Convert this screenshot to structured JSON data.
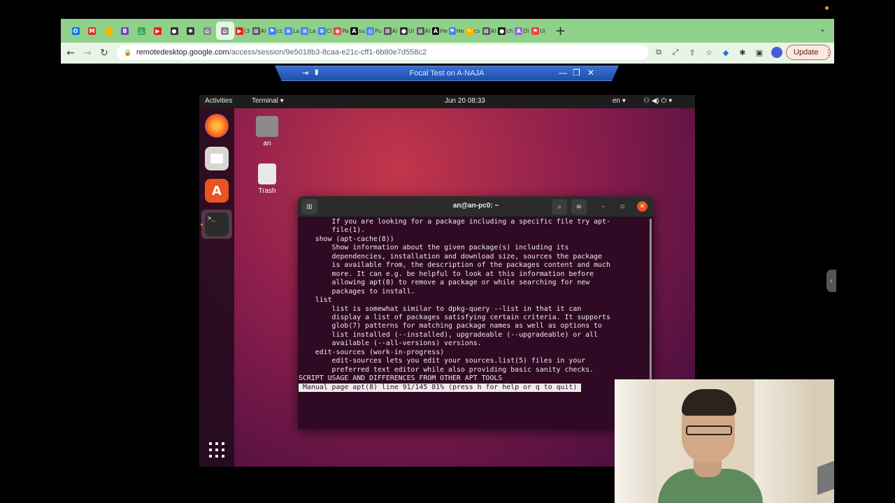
{
  "browser": {
    "tabs": [
      {
        "icon": "outlook-icon",
        "color": "#1a73e8",
        "glyph": "O",
        "label": ""
      },
      {
        "icon": "gmail-icon",
        "color": "#d93025",
        "glyph": "M",
        "label": ""
      },
      {
        "icon": "puzzle-yellow-icon",
        "color": "#f4b400",
        "glyph": "",
        "label": ""
      },
      {
        "icon": "bold-b-icon",
        "color": "#6f42c1",
        "glyph": "B",
        "label": ""
      },
      {
        "icon": "drive-icon",
        "color": "#34a853",
        "glyph": "△",
        "label": ""
      },
      {
        "icon": "youtube-icon",
        "color": "#e62117",
        "glyph": "▶",
        "label": ""
      },
      {
        "icon": "circle-dark-icon",
        "color": "#333",
        "glyph": "●",
        "label": ""
      },
      {
        "icon": "extension-icon",
        "color": "#333",
        "glyph": "✱",
        "label": ""
      },
      {
        "icon": "remote-desktop-icon",
        "color": "#888",
        "glyph": "⌂",
        "label": ""
      },
      {
        "icon": "remote-desktop-icon",
        "color": "#888",
        "glyph": "⌂",
        "label": "",
        "active": true
      },
      {
        "icon": "youtube-icon",
        "color": "#e62117",
        "glyph": "▶",
        "label": "(3"
      },
      {
        "icon": "ai-tab-icon",
        "color": "#555",
        "glyph": "⊞",
        "label": "Al"
      },
      {
        "icon": "flag-tab-icon",
        "color": "#4285f4",
        "glyph": "⚑",
        "label": "cc"
      },
      {
        "icon": "docs-icon",
        "color": "#4285f4",
        "glyph": "≡",
        "label": "La"
      },
      {
        "icon": "docs-icon",
        "color": "#4285f4",
        "glyph": "≡",
        "label": "La"
      },
      {
        "icon": "docs-icon",
        "color": "#4285f4",
        "glyph": "≡",
        "label": "Cl"
      },
      {
        "icon": "record-icon",
        "color": "#e8453c",
        "glyph": "◉",
        "label": "Pe"
      },
      {
        "icon": "a-tab-icon",
        "color": "#111",
        "glyph": "A",
        "label": "su"
      },
      {
        "icon": "chrome-icon",
        "color": "#4285f4",
        "glyph": "◎",
        "label": "Pu"
      },
      {
        "icon": "ai-tab-icon",
        "color": "#555",
        "glyph": "⊞",
        "label": "Al"
      },
      {
        "icon": "circle-dark-icon",
        "color": "#333",
        "glyph": "●",
        "label": "Ui"
      },
      {
        "icon": "ai-tab-icon",
        "color": "#555",
        "glyph": "⊞",
        "label": "Al"
      },
      {
        "icon": "a-tab-icon",
        "color": "#111",
        "glyph": "A",
        "label": "He"
      },
      {
        "icon": "flag-tab-icon",
        "color": "#4285f4",
        "glyph": "⚑",
        "label": "He"
      },
      {
        "icon": "pen-icon",
        "color": "#f4b400",
        "glyph": "✎",
        "label": "cs"
      },
      {
        "icon": "ai-tab-icon",
        "color": "#555",
        "glyph": "⊞",
        "label": "Al"
      },
      {
        "icon": "github-icon",
        "color": "#222",
        "glyph": "●",
        "label": "ch"
      },
      {
        "icon": "a-purple-icon",
        "color": "#8e6bd8",
        "glyph": "A",
        "label": "Di"
      },
      {
        "icon": "flag-red-icon",
        "color": "#ea4335",
        "glyph": "⚑",
        "label": "Ui"
      }
    ],
    "new_tab_glyph": "+",
    "tab_menu_glyph": "⌄",
    "back_glyph": "←",
    "forward_glyph": "→",
    "reload_glyph": "↻",
    "url_host": "remotedesktop.google.com",
    "url_path": "/access/session/9e5018b3-8caa-e21c-cff1-6b80e7d558c2",
    "update_label": "Update",
    "kebab_glyph": "⋮"
  },
  "remote_session": {
    "title": "Focal Test on A-NAJA",
    "pin_glyph": "⇥",
    "signal_glyph": "▮",
    "minimize_glyph": "—",
    "restore_glyph": "❐",
    "close_glyph": "✕"
  },
  "ubuntu": {
    "activities": "Activities",
    "app_menu": "Terminal ▾",
    "clock": "Jun 20  08:33",
    "lang": "en ▾",
    "status_icons": "⚇  ◀)  ⏻ ▾",
    "desktop_icons": [
      {
        "label": "an",
        "icon": "home-folder-icon"
      },
      {
        "label": "Trash",
        "icon": "trash-icon"
      }
    ]
  },
  "terminal": {
    "title": "an@an-pc0: ~",
    "new_tab_glyph": "⊞",
    "search_glyph": "⌕",
    "menu_glyph": "≡",
    "minimize_glyph": "–",
    "maximize_glyph": "▫",
    "close_glyph": "✕",
    "lines": [
      "        If you are looking for a package including a specific file try apt-",
      "        file(1).",
      "",
      "    show (apt-cache(8))",
      "        Show information about the given package(s) including its",
      "        dependencies, installation and download size, sources the package",
      "        is available from, the description of the packages content and much",
      "        more. It can e.g. be helpful to look at this information before",
      "        allowing apt(8) to remove a package or while searching for new",
      "        packages to install.",
      "",
      "    list",
      "        list is somewhat similar to dpkg-query --list in that it can",
      "        display a list of packages satisfying certain criteria. It supports",
      "        glob(7) patterns for matching package names as well as options to",
      "        list installed (--installed), upgradeable (--upgradeable) or all",
      "        available (--all-versions) versions.",
      "",
      "    edit-sources (work-in-progress)",
      "        edit-sources lets you edit your sources.list(5) files in your",
      "        preferred text editor while also providing basic sanity checks.",
      "",
      "SCRIPT USAGE AND DIFFERENCES FROM OTHER APT TOOLS"
    ],
    "status_line": " Manual page apt(8) line 91/145 81% (press h for help or q to quit) "
  }
}
